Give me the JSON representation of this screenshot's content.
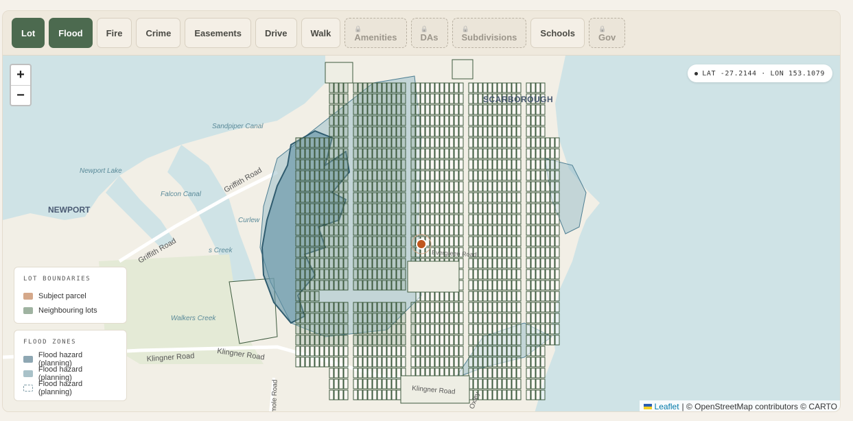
{
  "tabs": [
    {
      "label": "Lot",
      "state": "active",
      "name": "tab-lot"
    },
    {
      "label": "Flood",
      "state": "active",
      "name": "tab-flood"
    },
    {
      "label": "Fire",
      "state": "normal",
      "name": "tab-fire"
    },
    {
      "label": "Crime",
      "state": "normal",
      "name": "tab-crime"
    },
    {
      "label": "Easements",
      "state": "normal",
      "name": "tab-easements"
    },
    {
      "label": "Drive",
      "state": "normal",
      "name": "tab-drive"
    },
    {
      "label": "Walk",
      "state": "normal",
      "name": "tab-walk"
    },
    {
      "label": "Amenities",
      "state": "locked",
      "name": "tab-amenities"
    },
    {
      "label": "DAs",
      "state": "locked",
      "name": "tab-das"
    },
    {
      "label": "Subdivisions",
      "state": "locked",
      "name": "tab-subdivisions"
    },
    {
      "label": "Schools",
      "state": "normal",
      "name": "tab-schools"
    },
    {
      "label": "Gov",
      "state": "locked",
      "name": "tab-gov"
    }
  ],
  "lock_icon": "lock-icon",
  "map": {
    "zoom_in": "+",
    "zoom_out": "−",
    "coords": "LAT -27.2144 · LON 153.1079",
    "labels": {
      "scarborough": "SCARBOROUGH",
      "newport": "NEWPORT",
      "sandpiper_canal": "Sandpiper Canal",
      "newport_lake": "Newport Lake",
      "falcon_canal": "Falcon Canal",
      "griffith_road_1": "Griffith Road",
      "griffith_road_2": "Griffith Road",
      "curlew": "Curlew",
      "creek": "s Creek",
      "walkers_creek": "Walkers Creek",
      "klingner_road_1": "Klingner Road",
      "klingner_road_2": "Klingner Road",
      "klingner_road_3": "Klingner Road",
      "oxley": "Oxley",
      "mole_road": "mole Road",
      "evergreen_road": "Evergreen Road"
    },
    "colors": {
      "water": "#cfe3e6",
      "land": "#f2efe6",
      "lot_stroke": "#3d5a3e",
      "lot_fill": "#9fb5a2",
      "flood_dark": "#5d8fa3",
      "flood_light": "#9dbfca",
      "subject": "#c0571f"
    }
  },
  "legend_lots": {
    "title": "LOT BOUNDARIES",
    "items": [
      {
        "label": "Subject parcel",
        "color": "#d5a88a",
        "style": "solid"
      },
      {
        "label": "Neighbouring lots",
        "color": "#9fb3a1",
        "style": "solid"
      }
    ]
  },
  "legend_flood": {
    "title": "FLOOD ZONES",
    "items": [
      {
        "label": "Flood hazard (planning)",
        "color": "#8ea7b3",
        "style": "solid"
      },
      {
        "label": "Flood hazard (planning)",
        "color": "#a9c2c9",
        "style": "solid"
      },
      {
        "label": "Flood hazard (planning)",
        "color": "#ffffff",
        "style": "dashed"
      }
    ]
  },
  "attribution": {
    "leaflet": "Leaflet",
    "rest": "| © OpenStreetMap contributors © CARTO"
  }
}
